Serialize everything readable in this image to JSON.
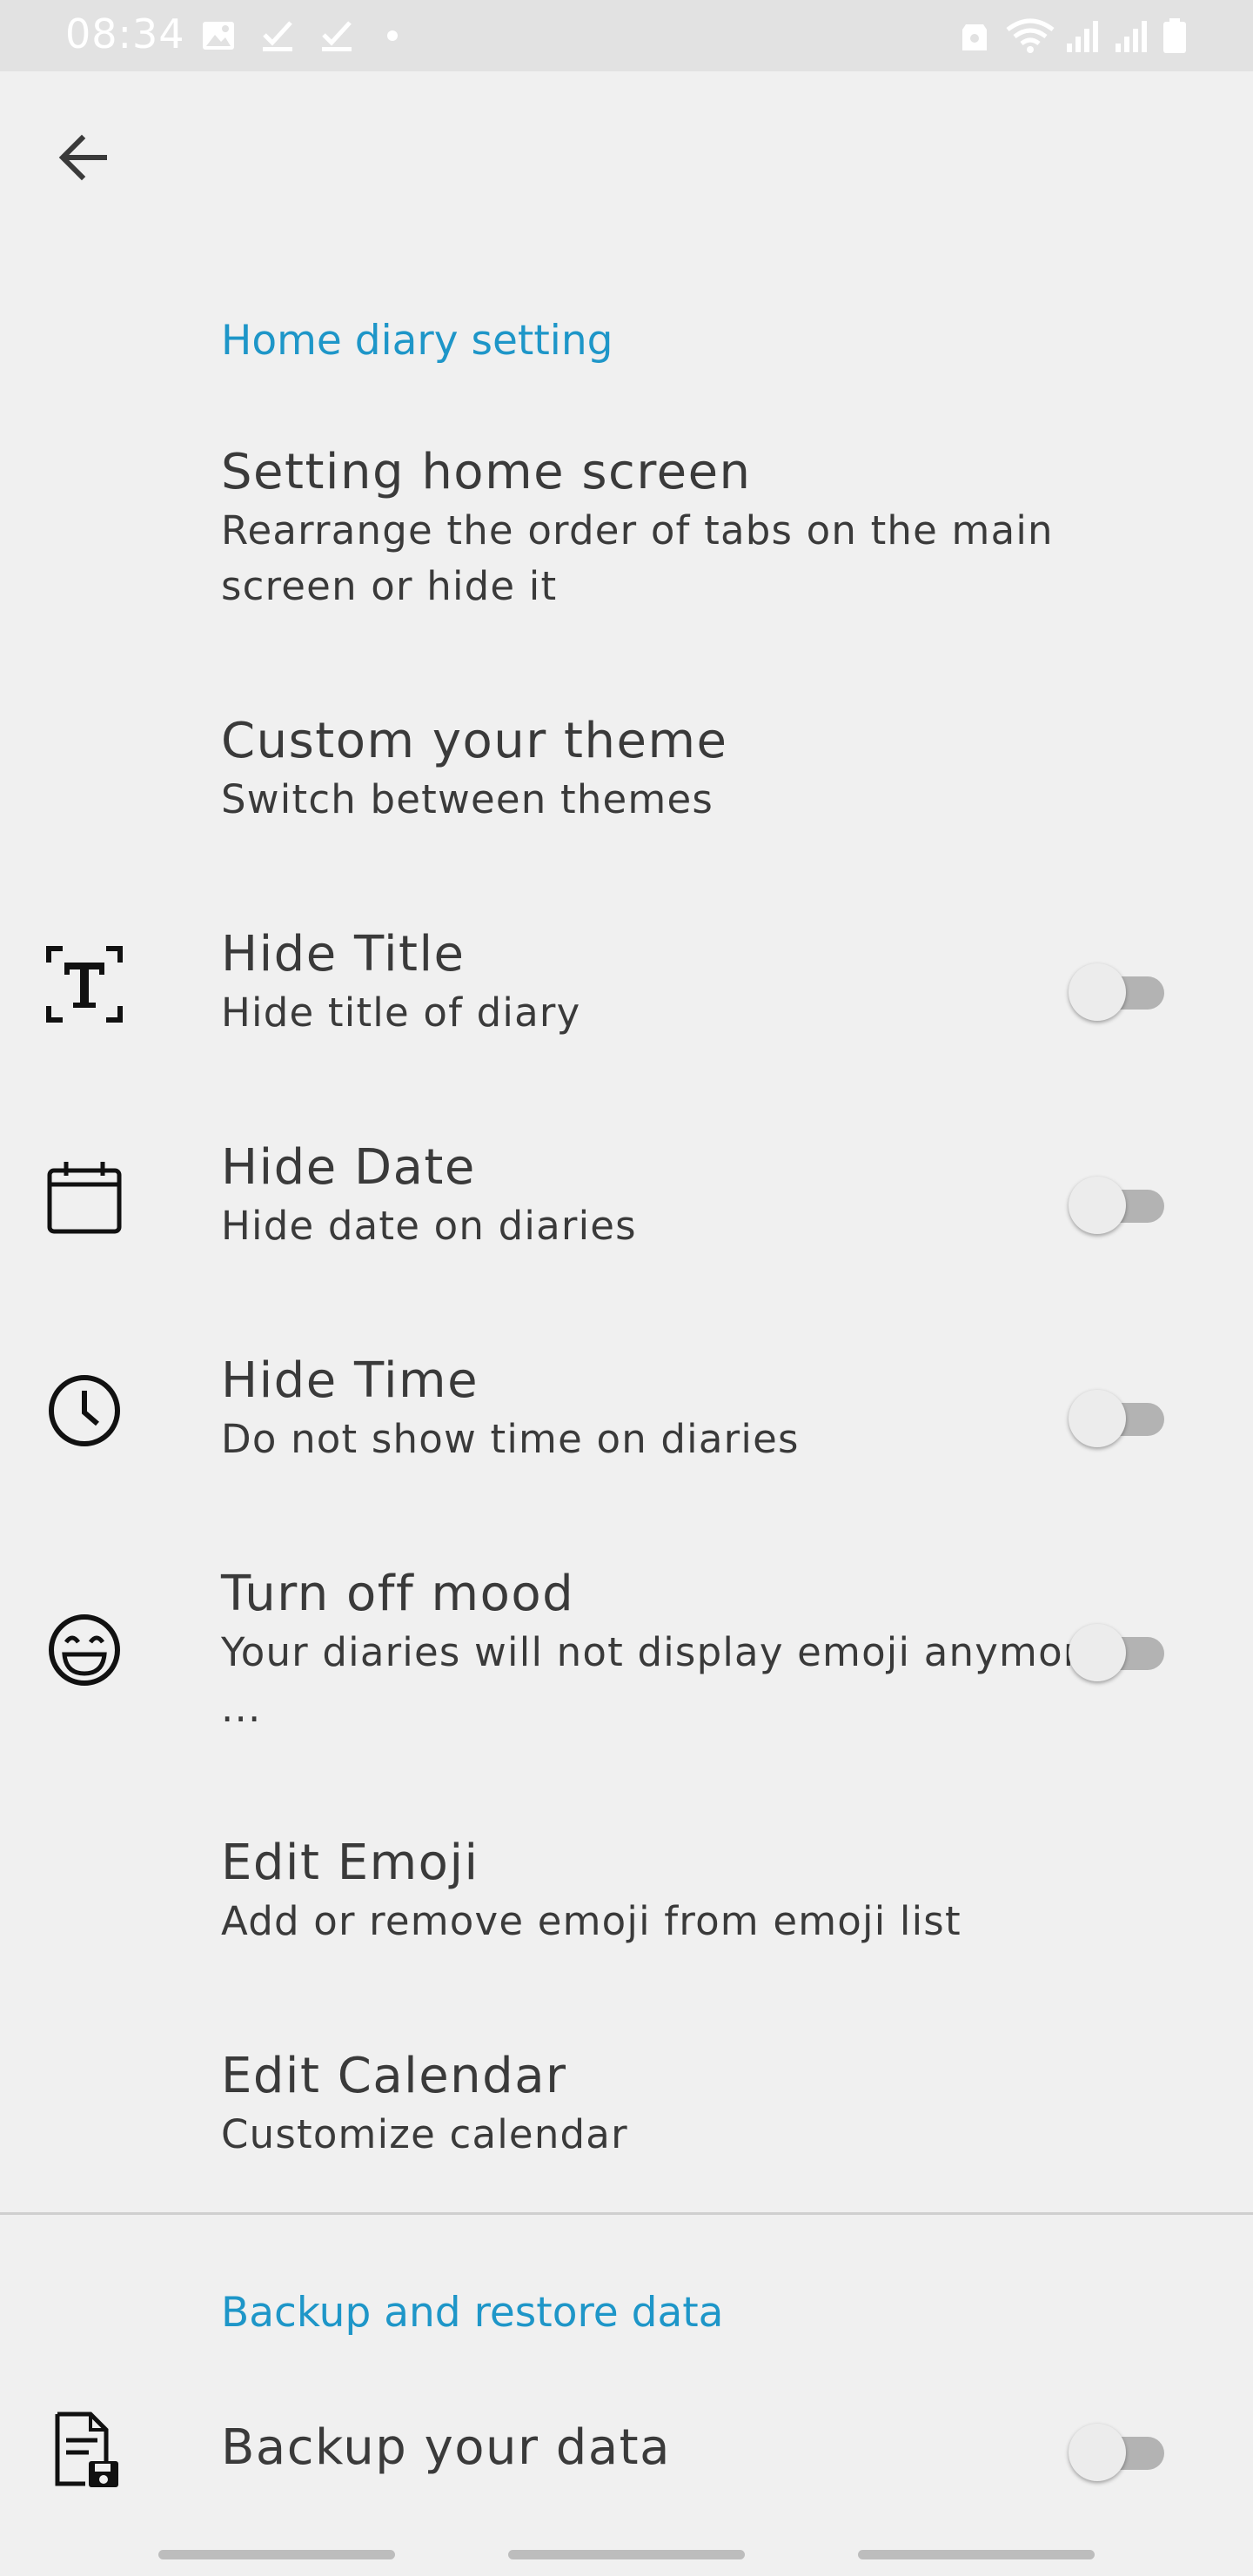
{
  "status_bar": {
    "time": "08:34",
    "left_icons": [
      "image-icon",
      "check-icon",
      "check-icon",
      "dot-icon"
    ],
    "right_icons": [
      "lock-icon",
      "wifi-icon",
      "signal-icon",
      "signal-icon",
      "battery-icon"
    ]
  },
  "toolbar": {
    "back_icon": "arrow-left-icon"
  },
  "sections": {
    "home": {
      "header": "Home diary setting"
    },
    "backup": {
      "header": "Backup and restore data"
    }
  },
  "items": [
    {
      "title": "Setting home screen",
      "subtitle": "Rearrange the order of tabs on the main screen or hide it"
    },
    {
      "title": "Custom your theme",
      "subtitle": "Switch between themes"
    },
    {
      "title": "Hide Title",
      "subtitle": "Hide title of diary",
      "icon": "text-title-icon",
      "toggle_on": false
    },
    {
      "title": "Hide Date",
      "subtitle": "Hide date on diaries",
      "icon": "calendar-icon",
      "toggle_on": false
    },
    {
      "title": "Hide Time",
      "subtitle": "Do not show time on diaries",
      "icon": "clock-icon",
      "toggle_on": false
    },
    {
      "title": "Turn off mood",
      "subtitle": "Your diaries will not display emoji anymore ...",
      "icon": "smile-icon",
      "toggle_on": false
    },
    {
      "title": "Edit Emoji",
      "subtitle": "Add or remove emoji from emoji list"
    },
    {
      "title": "Edit Calendar",
      "subtitle": "Customize calendar"
    },
    {
      "title": "Backup your data",
      "icon": "backup-file-icon",
      "toggle_on": false
    }
  ],
  "colors": {
    "background": "#f0f0f0",
    "accent": "#1e96c8",
    "text": "#3a3a3a",
    "toggle_track": "#b3b3b3",
    "toggle_thumb": "#ececec"
  }
}
